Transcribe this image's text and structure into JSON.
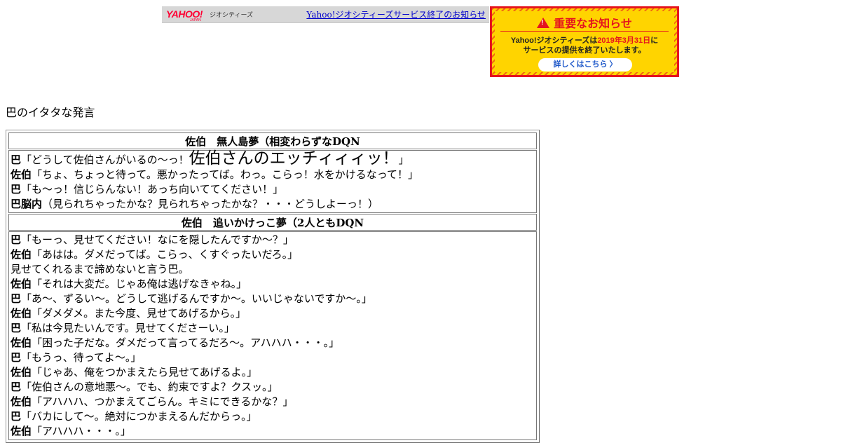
{
  "header": {
    "logo": "YAHOO!",
    "logo_sub": "JAPAN",
    "geo_name": "ジオシティーズ",
    "link_text": "Yahoo!ジオシティーズサービス終了のお知らせ"
  },
  "notice": {
    "title": "重要なお知らせ",
    "body_pre": "Yahoo!ジオシティーズは",
    "body_date": "2019年3月31日",
    "body_post": "に",
    "body_line2": "サービスの提供を終了いたします。",
    "button": "詳しくはこちら 〉"
  },
  "page_title": "巴のイタタな発言",
  "sections": [
    {
      "title": "佐伯　無人島夢（相変わらずなDQN",
      "lines": [
        {
          "speaker": "巴",
          "text": "「どうして佐伯さんがいるの～っ！",
          "big": "佐伯さんのエッチィィィッ！",
          "tail": "」"
        },
        {
          "speaker": "佐伯",
          "text": "「ちょ、ちょっと待って。悪かったってば。わっ。こらっ！水をかけるなって！」"
        },
        {
          "speaker": "巴",
          "text": "「も～っ！信じらんない！あっち向いててください！」"
        },
        {
          "speaker": "巴脳内",
          "text": "（見られちゃったかな？見られちゃったかな？・・・どうしよーっ！）"
        }
      ]
    },
    {
      "title": "佐伯　追いかけっこ夢（2人ともDQN",
      "lines": [
        {
          "speaker": "巴",
          "text": "「もーっ、見せてください！なにを隠したんですか～？」"
        },
        {
          "speaker": "佐伯",
          "text": "「あはは。ダメだってば。こらっ、くすぐったいだろ。」"
        },
        {
          "speaker": "",
          "text": "見せてくれるまで諦めないと言う巴。"
        },
        {
          "speaker": "佐伯",
          "text": "「それは大変だ。じゃあ俺は逃げなきゃね。」"
        },
        {
          "speaker": "巴",
          "text": "「あ～、ずるい～。どうして逃げるんですか～。いいじゃないですか～。」"
        },
        {
          "speaker": "佐伯",
          "text": "「ダメダメ。また今度、見せてあげるから。」"
        },
        {
          "speaker": "巴",
          "text": "「私は今見たいんです。見せてくださーい。」"
        },
        {
          "speaker": "佐伯",
          "text": "「困った子だな。ダメだって言ってるだろ～。アハハハ・・・。」"
        },
        {
          "speaker": "巴",
          "text": "「もうっ、待ってよ～。」"
        },
        {
          "speaker": "佐伯",
          "text": "「じゃあ、俺をつかまえたら見せてあげるよ。」"
        },
        {
          "speaker": "巴",
          "text": "「佐伯さんの意地悪～。でも、約束ですよ？クスッ。」"
        },
        {
          "speaker": "佐伯",
          "text": "「アハハハ、つかまえてごらん。キミにできるかな？」"
        },
        {
          "speaker": "巴",
          "text": "「バカにして～。絶対につかまえるんだからっ。」"
        },
        {
          "speaker": "佐伯",
          "text": "「アハハハ・・・。」"
        }
      ]
    }
  ]
}
